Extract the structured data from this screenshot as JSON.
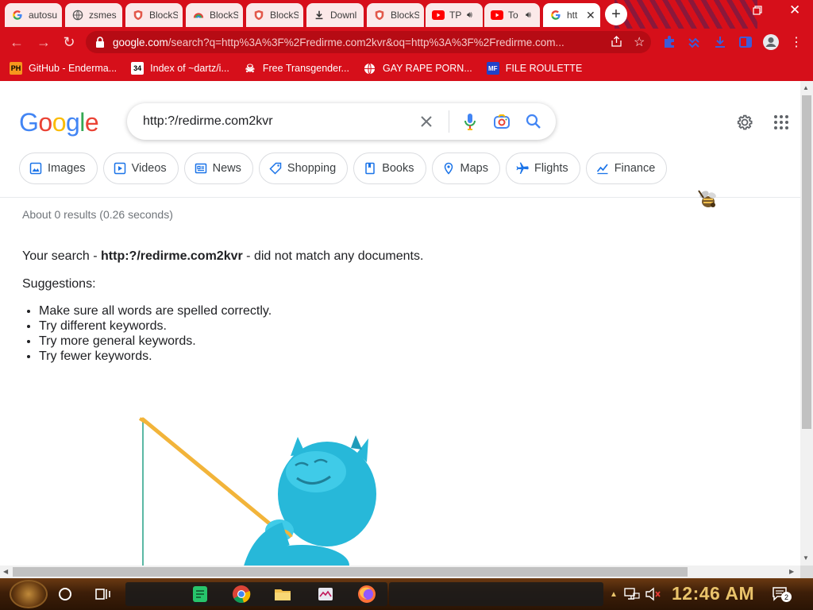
{
  "browser": {
    "tabs": [
      {
        "title": "autosu",
        "icon": "google-icon"
      },
      {
        "title": "zsmes",
        "icon": "globe-icon"
      },
      {
        "title": "BlockS",
        "icon": "brave-shield-icon"
      },
      {
        "title": "BlockS",
        "icon": "rainbow-icon"
      },
      {
        "title": "BlockS",
        "icon": "brave-shield-icon"
      },
      {
        "title": "Downl",
        "icon": "download-icon"
      },
      {
        "title": "BlockS",
        "icon": "brave-shield-icon"
      },
      {
        "title": "TP",
        "icon": "youtube-icon",
        "audio": true
      },
      {
        "title": "To",
        "icon": "youtube-icon",
        "audio": true
      },
      {
        "title": "htt",
        "icon": "google-icon",
        "active": true
      }
    ],
    "new_tab": "+",
    "url_host": "google.com",
    "url_rest": "/search?q=http%3A%3F%2Fredirme.com2kvr&oq=http%3A%3F%2Fredirme.com...",
    "bookmarks": [
      {
        "label": "GitHub - Enderma...",
        "icon": "PH"
      },
      {
        "label": "Index of ~dartz/i...",
        "icon": "34"
      },
      {
        "label": "Free Transgender...",
        "icon": "skull"
      },
      {
        "label": "GAY RAPE PORN...",
        "icon": "globe"
      },
      {
        "label": "FILE ROULETTE",
        "icon": "MF"
      }
    ],
    "accent_color": "#d60f1a"
  },
  "google": {
    "logo": "Google",
    "query": "http:?/redirme.com2kvr",
    "chips": [
      {
        "label": "Images",
        "icon": "image-icon"
      },
      {
        "label": "Videos",
        "icon": "play-icon"
      },
      {
        "label": "News",
        "icon": "news-icon"
      },
      {
        "label": "Shopping",
        "icon": "tag-icon"
      },
      {
        "label": "Books",
        "icon": "book-icon"
      },
      {
        "label": "Maps",
        "icon": "pin-icon"
      },
      {
        "label": "Flights",
        "icon": "plane-icon"
      },
      {
        "label": "Finance",
        "icon": "finance-icon"
      }
    ],
    "stats": "About 0 results (0.26 seconds)",
    "no_match_prefix": "Your search - ",
    "no_match_query": "http:?/redirme.com2kvr",
    "no_match_suffix": " - did not match any documents.",
    "suggestions_title": "Suggestions:",
    "suggestions": [
      "Make sure all words are spelled correctly.",
      "Try different keywords.",
      "Try more general keywords.",
      "Try fewer keywords."
    ]
  },
  "taskbar": {
    "clock": "12:46 AM",
    "notification_count": "2"
  }
}
